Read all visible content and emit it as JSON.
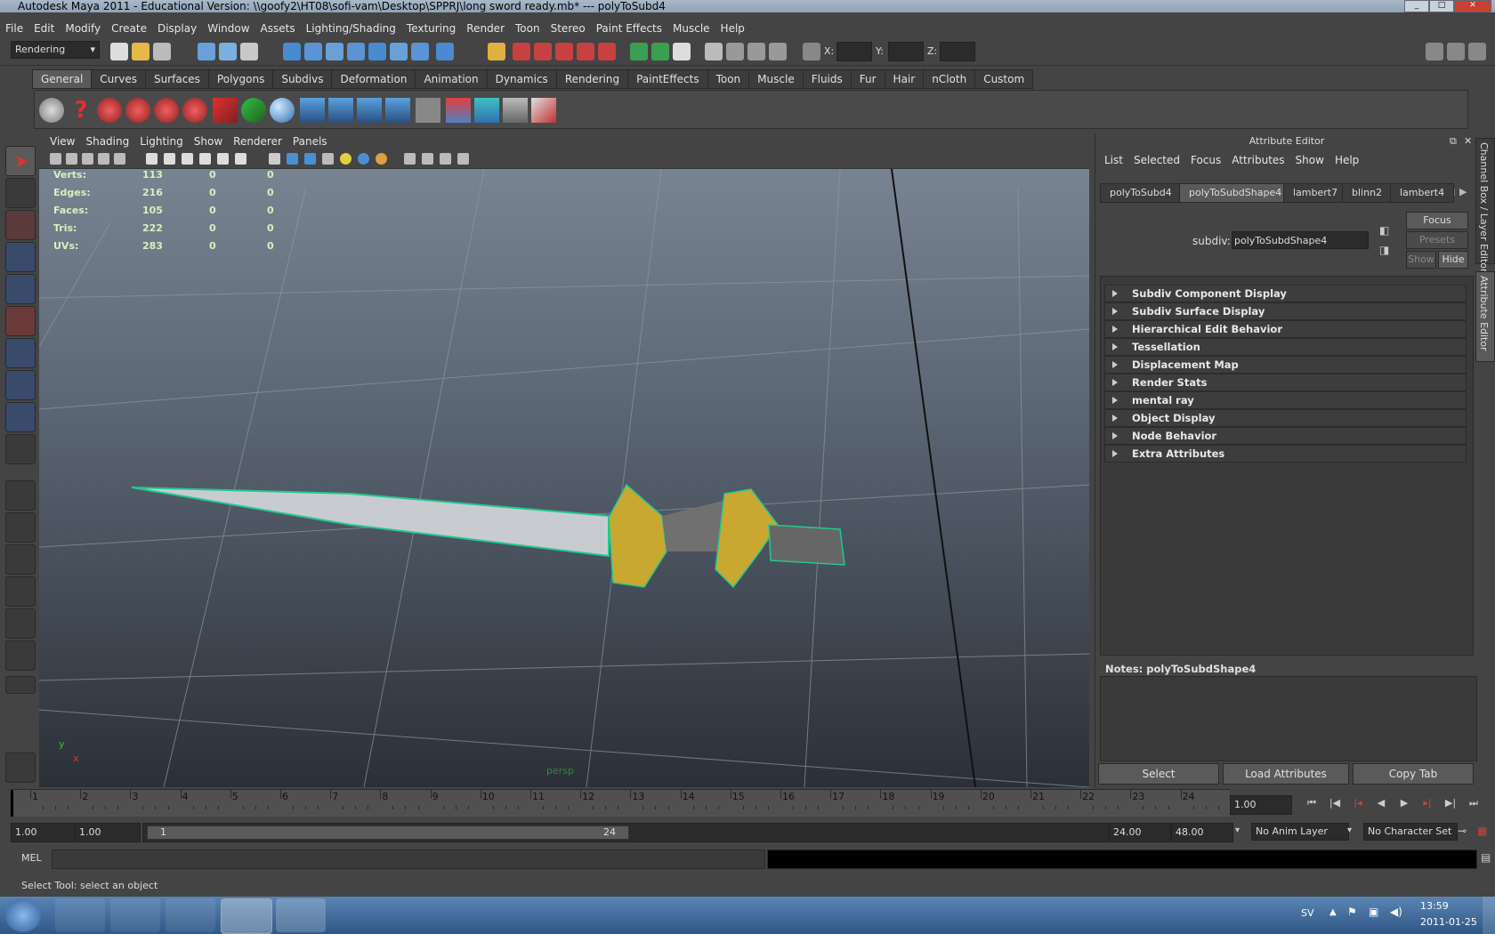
{
  "window": {
    "title": "Autodesk Maya 2011 - Educational Version: \\\\goofy2\\HT08\\sofi-vam\\Desktop\\SPPRJ\\long sword ready.mb*   ---   polyToSubd4"
  },
  "menubar": [
    "File",
    "Edit",
    "Modify",
    "Create",
    "Display",
    "Window",
    "Assets",
    "Lighting/Shading",
    "Texturing",
    "Render",
    "Toon",
    "Stereo",
    "Paint Effects",
    "Muscle",
    "Help"
  ],
  "statusline": {
    "menuset": "Rendering",
    "coords": {
      "x_label": "X:",
      "y_label": "Y:",
      "z_label": "Z:"
    }
  },
  "shelf": {
    "tabs": [
      "General",
      "Curves",
      "Surfaces",
      "Polygons",
      "Subdivs",
      "Deformation",
      "Animation",
      "Dynamics",
      "Rendering",
      "PaintEffects",
      "Toon",
      "Muscle",
      "Fluids",
      "Fur",
      "Hair",
      "nCloth",
      "Custom"
    ],
    "active_tab": "General"
  },
  "viewport": {
    "panel_menus": [
      "View",
      "Shading",
      "Lighting",
      "Show",
      "Renderer",
      "Panels"
    ],
    "hud": [
      {
        "label": "Verts:",
        "v1": "113",
        "v2": "0",
        "v3": "0"
      },
      {
        "label": "Edges:",
        "v1": "216",
        "v2": "0",
        "v3": "0"
      },
      {
        "label": "Faces:",
        "v1": "105",
        "v2": "0",
        "v3": "0"
      },
      {
        "label": "Tris:",
        "v1": "222",
        "v2": "0",
        "v3": "0"
      },
      {
        "label": "UVs:",
        "v1": "283",
        "v2": "0",
        "v3": "0"
      }
    ],
    "camera_label": "persp",
    "axis_labels": {
      "y": "y",
      "x": "x"
    }
  },
  "attribute_editor": {
    "title": "Attribute Editor",
    "menus": [
      "List",
      "Selected",
      "Focus",
      "Attributes",
      "Show",
      "Help"
    ],
    "tabs": [
      "polyToSubd4",
      "polyToSubdShape4",
      "lambert7",
      "blinn2",
      "lambert4"
    ],
    "active_tab": "polyToSubdShape4",
    "node_label": "subdiv:",
    "node_value": "polyToSubdShape4",
    "side_buttons": {
      "focus": "Focus",
      "presets": "Presets",
      "show": "Show",
      "hide": "Hide"
    },
    "sections": [
      "Subdiv Component Display",
      "Subdiv Surface Display",
      "Hierarchical Edit Behavior",
      "Tessellation",
      "Displacement Map",
      "Render Stats",
      "mental ray",
      "Object Display",
      "Node Behavior",
      "Extra Attributes"
    ],
    "notes_label": "Notes:  polyToSubdShape4",
    "buttons": {
      "select": "Select",
      "load": "Load Attributes",
      "copy": "Copy Tab"
    },
    "side_tabs": [
      "Channel Box / Layer Editor",
      "Attribute Editor"
    ]
  },
  "timeslider": {
    "ticks": [
      "1",
      "2",
      "3",
      "4",
      "5",
      "6",
      "7",
      "8",
      "9",
      "10",
      "11",
      "12",
      "13",
      "14",
      "15",
      "16",
      "17",
      "18",
      "19",
      "20",
      "21",
      "22",
      "23",
      "24"
    ],
    "current_time": "1.00"
  },
  "rangeslider": {
    "start": "1.00",
    "inner_start": "1.00",
    "range_start_label": "1",
    "range_end_label": "24",
    "end": "24.00",
    "outer_end": "48.00",
    "anim_layer": "No Anim Layer",
    "char_set": "No Character Set"
  },
  "cmdline": {
    "label": "MEL"
  },
  "helpline": {
    "text": "Select Tool: select an object"
  },
  "taskbar": {
    "lang": "SV",
    "time": "13:59",
    "date": "2011-01-25"
  }
}
